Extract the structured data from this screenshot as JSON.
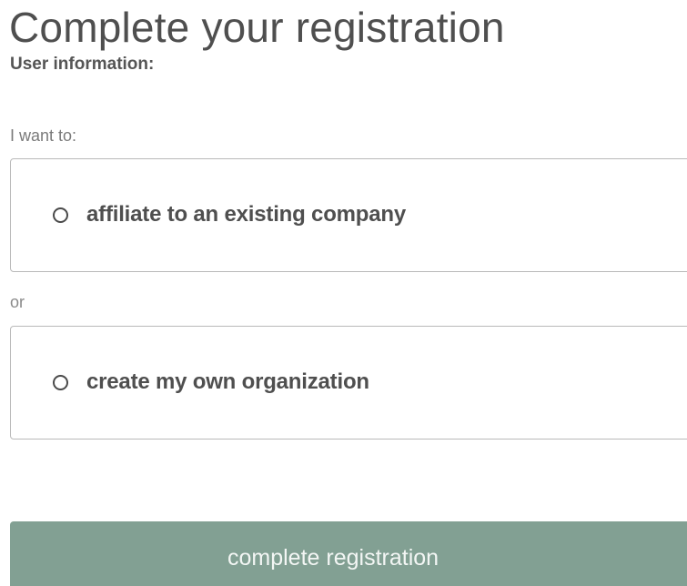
{
  "header": {
    "title": "Complete your registration",
    "subtitle": "User information:"
  },
  "form": {
    "prompt": "I want to:",
    "options": [
      {
        "label": "affiliate to an existing company",
        "selected": false
      },
      {
        "label": "create my own organization",
        "selected": false
      }
    ],
    "separator": "or",
    "submit_label": "complete registration"
  },
  "colors": {
    "accent": "#82a093",
    "text": "#4f4f4f",
    "border": "#b9b9b9"
  }
}
